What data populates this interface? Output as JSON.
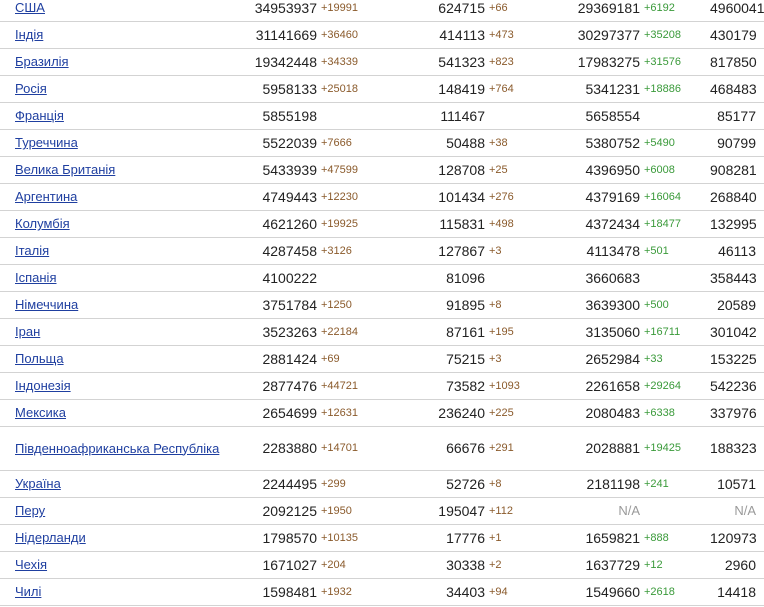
{
  "rows": [
    {
      "country": "США",
      "cases": "34953937",
      "cases_new": "+19991",
      "deaths": "624715",
      "deaths_new": "+66",
      "recovered": "29369181",
      "recovered_new": "+6192",
      "active": "4960041"
    },
    {
      "country": "Індія",
      "cases": "31141669",
      "cases_new": "+36460",
      "deaths": "414113",
      "deaths_new": "+473",
      "recovered": "30297377",
      "recovered_new": "+35208",
      "active": "430179"
    },
    {
      "country": "Бразилія",
      "cases": "19342448",
      "cases_new": "+34339",
      "deaths": "541323",
      "deaths_new": "+823",
      "recovered": "17983275",
      "recovered_new": "+31576",
      "active": "817850"
    },
    {
      "country": "Росія",
      "cases": "5958133",
      "cases_new": "+25018",
      "deaths": "148419",
      "deaths_new": "+764",
      "recovered": "5341231",
      "recovered_new": "+18886",
      "active": "468483"
    },
    {
      "country": "Франція",
      "cases": "5855198",
      "cases_new": "",
      "deaths": "111467",
      "deaths_new": "",
      "recovered": "5658554",
      "recovered_new": "",
      "active": "85177"
    },
    {
      "country": "Туреччина",
      "cases": "5522039",
      "cases_new": "+7666",
      "deaths": "50488",
      "deaths_new": "+38",
      "recovered": "5380752",
      "recovered_new": "+5490",
      "active": "90799"
    },
    {
      "country": "Велика Британія",
      "cases": "5433939",
      "cases_new": "+47599",
      "deaths": "128708",
      "deaths_new": "+25",
      "recovered": "4396950",
      "recovered_new": "+6008",
      "active": "908281"
    },
    {
      "country": "Аргентина",
      "cases": "4749443",
      "cases_new": "+12230",
      "deaths": "101434",
      "deaths_new": "+276",
      "recovered": "4379169",
      "recovered_new": "+16064",
      "active": "268840"
    },
    {
      "country": "Колумбія",
      "cases": "4621260",
      "cases_new": "+19925",
      "deaths": "115831",
      "deaths_new": "+498",
      "recovered": "4372434",
      "recovered_new": "+18477",
      "active": "132995"
    },
    {
      "country": "Італія",
      "cases": "4287458",
      "cases_new": "+3126",
      "deaths": "127867",
      "deaths_new": "+3",
      "recovered": "4113478",
      "recovered_new": "+501",
      "active": "46113"
    },
    {
      "country": "Іспанія",
      "cases": "4100222",
      "cases_new": "",
      "deaths": "81096",
      "deaths_new": "",
      "recovered": "3660683",
      "recovered_new": "",
      "active": "358443"
    },
    {
      "country": "Німеччина",
      "cases": "3751784",
      "cases_new": "+1250",
      "deaths": "91895",
      "deaths_new": "+8",
      "recovered": "3639300",
      "recovered_new": "+500",
      "active": "20589"
    },
    {
      "country": "Іран",
      "cases": "3523263",
      "cases_new": "+22184",
      "deaths": "87161",
      "deaths_new": "+195",
      "recovered": "3135060",
      "recovered_new": "+16711",
      "active": "301042"
    },
    {
      "country": "Польща",
      "cases": "2881424",
      "cases_new": "+69",
      "deaths": "75215",
      "deaths_new": "+3",
      "recovered": "2652984",
      "recovered_new": "+33",
      "active": "153225"
    },
    {
      "country": "Індонезія",
      "cases": "2877476",
      "cases_new": "+44721",
      "deaths": "73582",
      "deaths_new": "+1093",
      "recovered": "2261658",
      "recovered_new": "+29264",
      "active": "542236"
    },
    {
      "country": "Мексика",
      "cases": "2654699",
      "cases_new": "+12631",
      "deaths": "236240",
      "deaths_new": "+225",
      "recovered": "2080483",
      "recovered_new": "+6338",
      "active": "337976"
    },
    {
      "country": "Південноафриканська Республіка",
      "cases": "2283880",
      "cases_new": "+14701",
      "deaths": "66676",
      "deaths_new": "+291",
      "recovered": "2028881",
      "recovered_new": "+19425",
      "active": "188323"
    },
    {
      "country": "Україна",
      "cases": "2244495",
      "cases_new": "+299",
      "deaths": "52726",
      "deaths_new": "+8",
      "recovered": "2181198",
      "recovered_new": "+241",
      "active": "10571"
    },
    {
      "country": "Перу",
      "cases": "2092125",
      "cases_new": "+1950",
      "deaths": "195047",
      "deaths_new": "+112",
      "recovered": "N/A",
      "recovered_new": "",
      "active": "N/A"
    },
    {
      "country": "Нідерланди",
      "cases": "1798570",
      "cases_new": "+10135",
      "deaths": "17776",
      "deaths_new": "+1",
      "recovered": "1659821",
      "recovered_new": "+888",
      "active": "120973"
    },
    {
      "country": "Чехія",
      "cases": "1671027",
      "cases_new": "+204",
      "deaths": "30338",
      "deaths_new": "+2",
      "recovered": "1637729",
      "recovered_new": "+12",
      "active": "2960"
    },
    {
      "country": "Чилі",
      "cases": "1598481",
      "cases_new": "+1932",
      "deaths": "34403",
      "deaths_new": "+94",
      "recovered": "1549660",
      "recovered_new": "+2618",
      "active": "14418"
    }
  ],
  "colors": {
    "link": "#1f3fa0",
    "increase": "#8a5a2b",
    "recovered_increase": "#3a9a3a",
    "na": "#9a9a9a",
    "border": "#d3d3d3"
  }
}
